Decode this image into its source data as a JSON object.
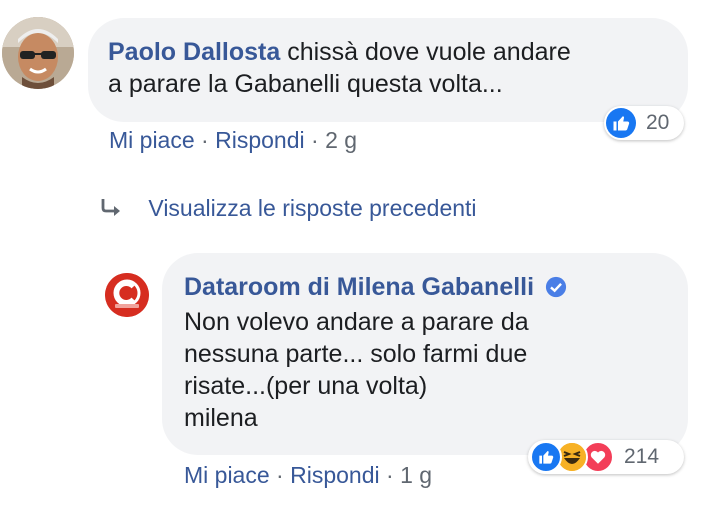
{
  "comment": {
    "author": "Paolo Dallosta",
    "text_line1": "chissà dove vuole andare",
    "text_line2": "a parare la Gabanelli questa volta...",
    "actions": {
      "like": "Mi piace",
      "reply": "Rispondi",
      "time": "2 g",
      "sep": "·"
    },
    "reactions": {
      "count": "20",
      "icons": [
        "like-icon"
      ]
    }
  },
  "view_replies": {
    "label": "Visualizza le risposte precedenti",
    "icon": "reply-arrow-icon"
  },
  "reply": {
    "author": "Dataroom di Milena Gabanelli",
    "verified": true,
    "lines": [
      "Non volevo andare a parare da",
      "nessuna parte... solo farmi due",
      "risate...(per una volta)",
      "milena"
    ],
    "actions": {
      "like": "Mi piace",
      "reply": "Rispondi",
      "time": "1 g",
      "sep": "·"
    },
    "reactions": {
      "count": "214",
      "icons": [
        "like-icon",
        "haha-icon",
        "love-icon"
      ]
    }
  },
  "colors": {
    "link": "#385898",
    "bubble": "#f2f3f5",
    "like": "#1877f2",
    "haha": "#f7b125",
    "love": "#f33e58"
  }
}
